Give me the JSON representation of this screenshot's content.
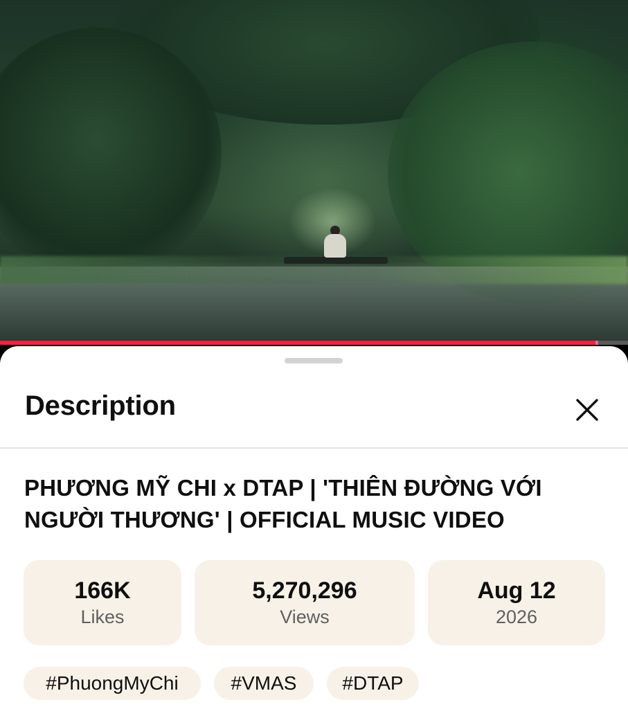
{
  "video": {
    "progress_fraction": 0.948,
    "progress_color": "#ff1f3d"
  },
  "panel": {
    "title": "Description",
    "close_icon": "close-icon"
  },
  "description": {
    "video_title": "PHƯƠNG MỸ CHI x DTAP | 'THIÊN ĐƯỜNG VỚI NGƯỜI THƯƠNG' | OFFICIAL MUSIC VIDEO",
    "stats": [
      {
        "value": "166K",
        "label": "Likes"
      },
      {
        "value": "5,270,296",
        "label": "Views"
      },
      {
        "value": "Aug 12",
        "label": "2026"
      }
    ],
    "hashtags": [
      "#PhuongMyChi",
      "#VMAS",
      "#DTAP"
    ]
  },
  "colors": {
    "chip_background": "#f7f1e7",
    "text_primary": "#0f0f0f",
    "text_secondary": "#606060"
  }
}
